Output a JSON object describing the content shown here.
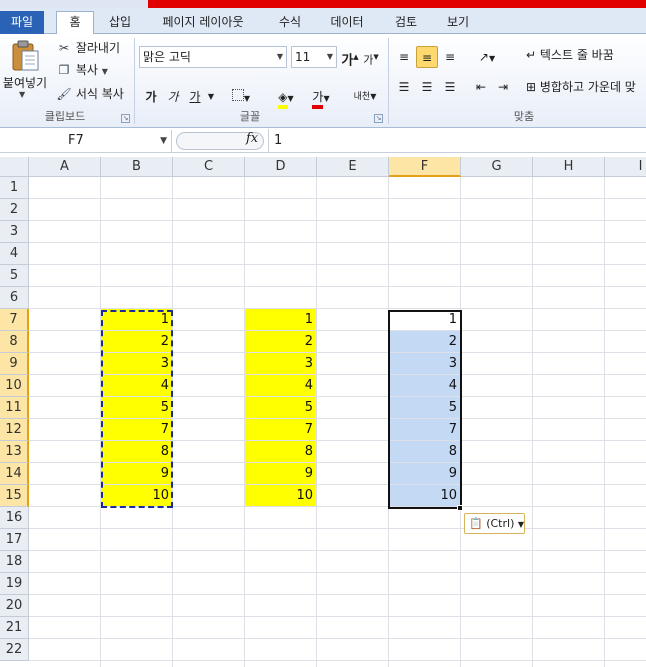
{
  "ribbon_tabs": {
    "file": "파일",
    "home": "홈",
    "insert": "삽입",
    "page_layout": "페이지 레이아웃",
    "formulas": "수식",
    "data": "데이터",
    "review": "검토",
    "view": "보기"
  },
  "clipboard": {
    "paste": "붙여넣기",
    "cut": "잘라내기",
    "copy": "복사",
    "format_painter": "서식 복사",
    "group": "클립보드"
  },
  "font": {
    "name": "맑은 고딕",
    "size": "11",
    "group": "글꼴",
    "grow": "가",
    "shrink": "가",
    "bold": "가",
    "italic": "가",
    "underline": "가",
    "color_letter": "가",
    "phonetic": "내천"
  },
  "alignment": {
    "wrap_text": "텍스트 줄 바꿈",
    "merge_center": "병합하고 가운데 맞",
    "group": "맞춤"
  },
  "formula_bar": {
    "name_box": "F7",
    "fx": "fx",
    "value": "1"
  },
  "columns": [
    "A",
    "B",
    "C",
    "D",
    "E",
    "F",
    "G",
    "H",
    "I"
  ],
  "rows": [
    "1",
    "2",
    "3",
    "4",
    "5",
    "6",
    "7",
    "8",
    "9",
    "10",
    "11",
    "12",
    "13",
    "14",
    "15",
    "16",
    "17",
    "18",
    "19",
    "20",
    "21",
    "22"
  ],
  "col_b_values": [
    "1",
    "2",
    "3",
    "4",
    "5",
    "7",
    "8",
    "9",
    "10"
  ],
  "col_d_values": [
    "1",
    "2",
    "3",
    "4",
    "5",
    "7",
    "8",
    "9",
    "10"
  ],
  "col_f_values": [
    "1",
    "2",
    "3",
    "4",
    "5",
    "7",
    "8",
    "9",
    "10"
  ],
  "paste_options": {
    "label": "(Ctrl)"
  },
  "colors": {
    "highlight": "#ffff00",
    "selection": "#c4daf4",
    "header_selected": "#fde6a5",
    "file_tab": "#2a63b5"
  }
}
